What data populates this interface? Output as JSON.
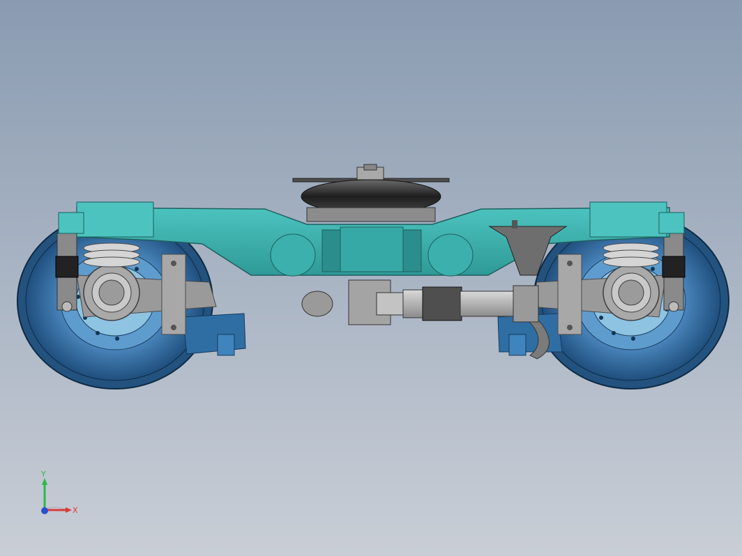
{
  "colors": {
    "frame": "#3fb3b0",
    "frame_dark": "#2b8e8c",
    "wheel": "#3a78b0",
    "wheel_dark": "#1f4f7e",
    "steel": "#b5b5b5",
    "steel_dark": "#6f6f6f",
    "rubber": "#2b2b2b",
    "axis_x": "#d93a3a",
    "axis_y": "#2db84a",
    "axis_z": "#2a4fd0"
  },
  "triad": {
    "x_label": "X",
    "y_label": "Y"
  }
}
